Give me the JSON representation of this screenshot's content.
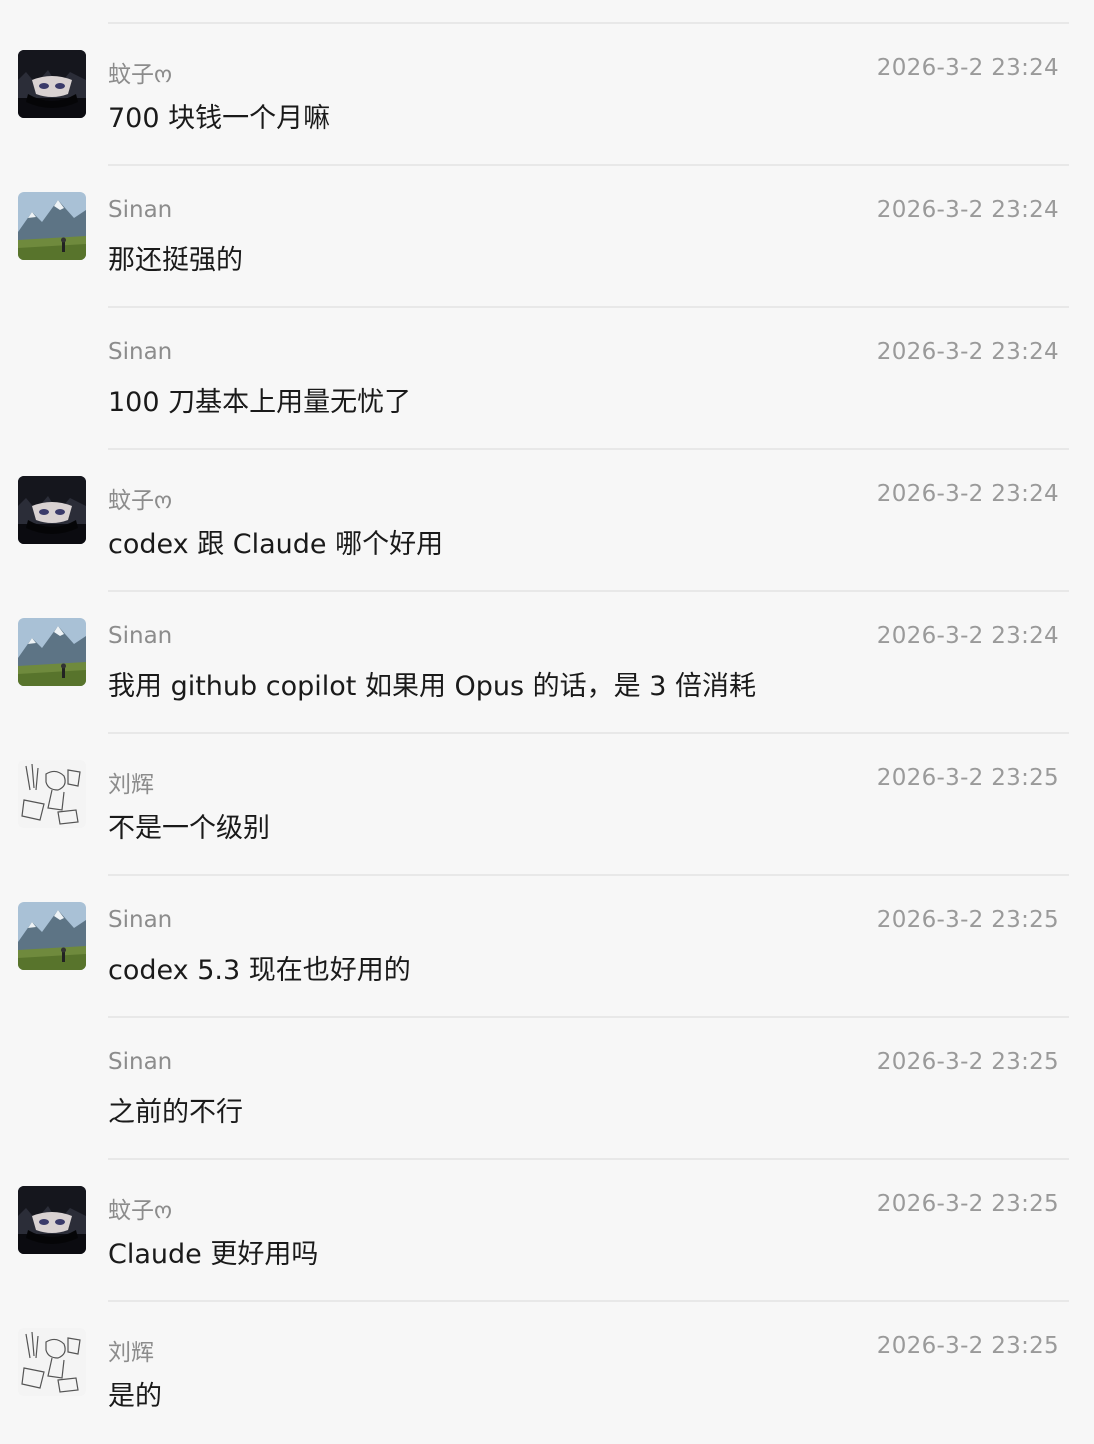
{
  "messages": [
    {
      "sender": "蚊子ო",
      "time": "2026-3-2 23:24",
      "text": "700 块钱一个月嘛",
      "avatar": "anime-avatar-icon"
    },
    {
      "sender": "Sinan",
      "time": "2026-3-2 23:24",
      "text": "那还挺强的",
      "avatar": "mountain-avatar-icon"
    },
    {
      "sender": "Sinan",
      "time": "2026-3-2 23:24",
      "text": "100 刀基本上用量无忧了",
      "avatar": ""
    },
    {
      "sender": "蚊子ო",
      "time": "2026-3-2 23:24",
      "text": "codex 跟 Claude 哪个好用",
      "avatar": "anime-avatar-icon"
    },
    {
      "sender": "Sinan",
      "time": "2026-3-2 23:24",
      "text": "我用 github copilot 如果用 Opus 的话，是 3 倍消耗",
      "avatar": "mountain-avatar-icon"
    },
    {
      "sender": "刘辉",
      "time": "2026-3-2 23:25",
      "text": "不是一个级别",
      "avatar": "sketch-avatar-icon"
    },
    {
      "sender": "Sinan",
      "time": "2026-3-2 23:25",
      "text": "codex 5.3 现在也好用的",
      "avatar": "mountain-avatar-icon"
    },
    {
      "sender": "Sinan",
      "time": "2026-3-2 23:25",
      "text": "之前的不行",
      "avatar": ""
    },
    {
      "sender": "蚊子ო",
      "time": "2026-3-2 23:25",
      "text": "Claude 更好用吗",
      "avatar": "anime-avatar-icon"
    },
    {
      "sender": "刘辉",
      "time": "2026-3-2 23:25",
      "text": "是的",
      "avatar": "sketch-avatar-icon"
    }
  ]
}
